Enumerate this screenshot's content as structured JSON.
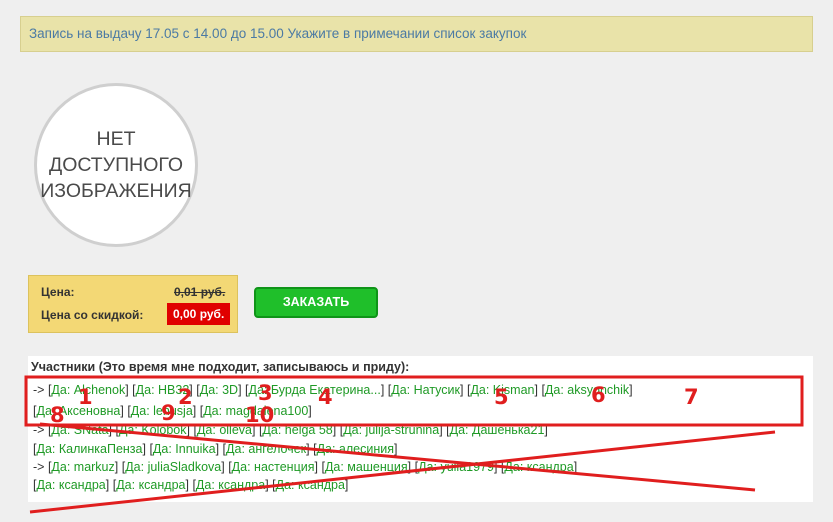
{
  "notice": {
    "text": "Запись на выдачу 17.05 с 14.00 до 15.00 Укажите в примечании список закупок"
  },
  "no_image": {
    "line1": "НЕТ",
    "line2": "ДОСТУПНОГО",
    "line3": "ИЗОБРАЖЕНИЯ"
  },
  "price": {
    "label": "Цена:",
    "value": "0,01 руб.",
    "discount_label": "Цена со скидкой:",
    "discount_value": "0,00 руб."
  },
  "order_button": "ЗАКАЗАТЬ",
  "participants": {
    "title": "Участники (Это время мне подходит, записываюсь и приду):",
    "prefix": "Да:",
    "arrow": "->",
    "lines": [
      [
        "Alchenok",
        "НВ32",
        "3D",
        "Бурда Екатерина...",
        "Натусик",
        "Kisman",
        "aksyonchik"
      ],
      [
        "Аксеновна",
        "lenusja",
        "magdalena100"
      ],
      [
        "SNata",
        "Kolobok",
        "olleva",
        "helga 58",
        "julija-strunina",
        "Дашенька21"
      ],
      [
        "КалинкаПенза",
        "Innuika",
        "ангелочек",
        "алесиния"
      ],
      [
        "markuz",
        "juliaSladkova",
        "настенция",
        "машенция",
        "yulia1979",
        "ксандра"
      ],
      [
        "ксандра",
        "ксандра",
        "ксандра",
        "ксандра"
      ]
    ]
  },
  "annotation": {
    "numbers": [
      "1",
      "2",
      "3",
      "4",
      "5",
      "6",
      "7",
      "8",
      "9",
      "10"
    ],
    "color": "#e01e1e"
  }
}
